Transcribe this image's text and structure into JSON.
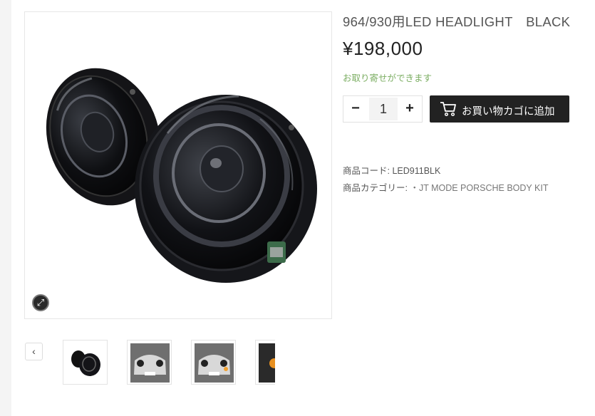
{
  "product": {
    "title": "964/930用LED HEADLIGHT　BLACK",
    "price": "¥198,000",
    "stock_note": "お取り寄せができます"
  },
  "cart": {
    "minus_label": "−",
    "quantity": "1",
    "plus_label": "+",
    "add_label": "お買い物カゴに追加",
    "icon": "shopping-cart-icon"
  },
  "meta": {
    "code_label": "商品コード: ",
    "code_value": "LED911BLK",
    "category_label": "商品カテゴリー: ",
    "category_value": "・JT MODE PORSCHE BODY KIT"
  },
  "gallery": {
    "zoom_icon": "expand-icon",
    "prev_label": "‹",
    "thumbnails": [
      "headlight-pair",
      "car-front-1",
      "car-front-2",
      "car-partial"
    ]
  },
  "colors": {
    "accent_dark": "#222222",
    "stock_green": "#7cae63"
  }
}
